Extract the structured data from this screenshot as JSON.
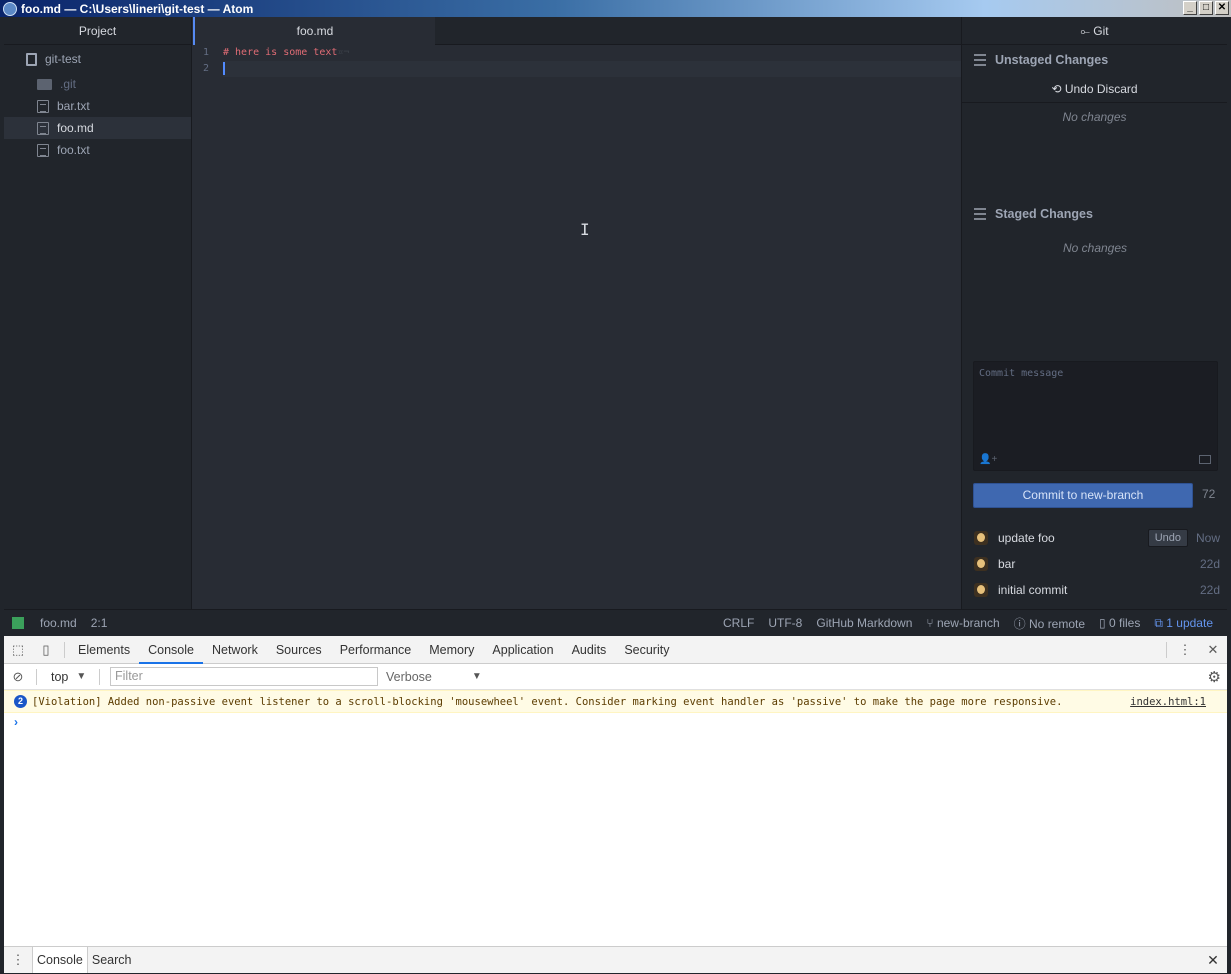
{
  "window": {
    "title": "foo.md — C:\\Users\\lineri\\git-test — Atom",
    "controls": [
      "_",
      "□",
      "✕"
    ]
  },
  "tree": {
    "header": "Project",
    "root": "git-test",
    "items": [
      {
        "label": ".git",
        "kind": "folder-icon",
        "ignored": true
      },
      {
        "label": "bar.txt",
        "kind": "file-icon"
      },
      {
        "label": "foo.md",
        "kind": "file-icon",
        "selected": true
      },
      {
        "label": "foo.txt",
        "kind": "file-icon"
      }
    ]
  },
  "editor": {
    "tab": "foo.md",
    "lines": [
      {
        "num": "1",
        "text": "# here is some text",
        "trail": "¤¬"
      },
      {
        "num": "2",
        "text": ""
      }
    ]
  },
  "git": {
    "tab": "Git",
    "unstaged_title": "Unstaged Changes",
    "undo_discard": "Undo Discard",
    "unstaged_empty": "No changes",
    "staged_title": "Staged Changes",
    "staged_empty": "No changes",
    "commit_placeholder": "Commit message",
    "commit_button": "Commit to new-branch",
    "char_count": "72",
    "recent_commits": [
      {
        "message": "update foo",
        "when": "Now",
        "undo": "Undo"
      },
      {
        "message": "bar",
        "when": "22d"
      },
      {
        "message": "initial commit",
        "when": "22d"
      }
    ]
  },
  "status": {
    "file": "foo.md",
    "cursor": "2:1",
    "line_ending": "CRLF",
    "encoding": "UTF-8",
    "grammar": "GitHub Markdown",
    "branch": "new-branch",
    "remote": "No remote",
    "files": "0 files",
    "update": "1 update"
  },
  "devtools": {
    "tabs": [
      "Elements",
      "Console",
      "Network",
      "Sources",
      "Performance",
      "Memory",
      "Application",
      "Audits",
      "Security"
    ],
    "active_tab": "Console",
    "context": "top",
    "filter_placeholder": "Filter",
    "level": "Verbose",
    "violation_count": "2",
    "violation_text": "[Violation] Added non-passive event listener to a scroll-blocking 'mousewheel' event. Consider marking event handler as 'passive' to make the page more responsive.",
    "violation_source": "index.html:1",
    "prompt": "›",
    "drawer_tabs": [
      "Console",
      "Search"
    ]
  },
  "colors": {
    "accent": "#568af2",
    "commit_button": "#3f68b0",
    "markdown_heading": "#e06c75",
    "devtools_accent": "#1a73e8"
  }
}
